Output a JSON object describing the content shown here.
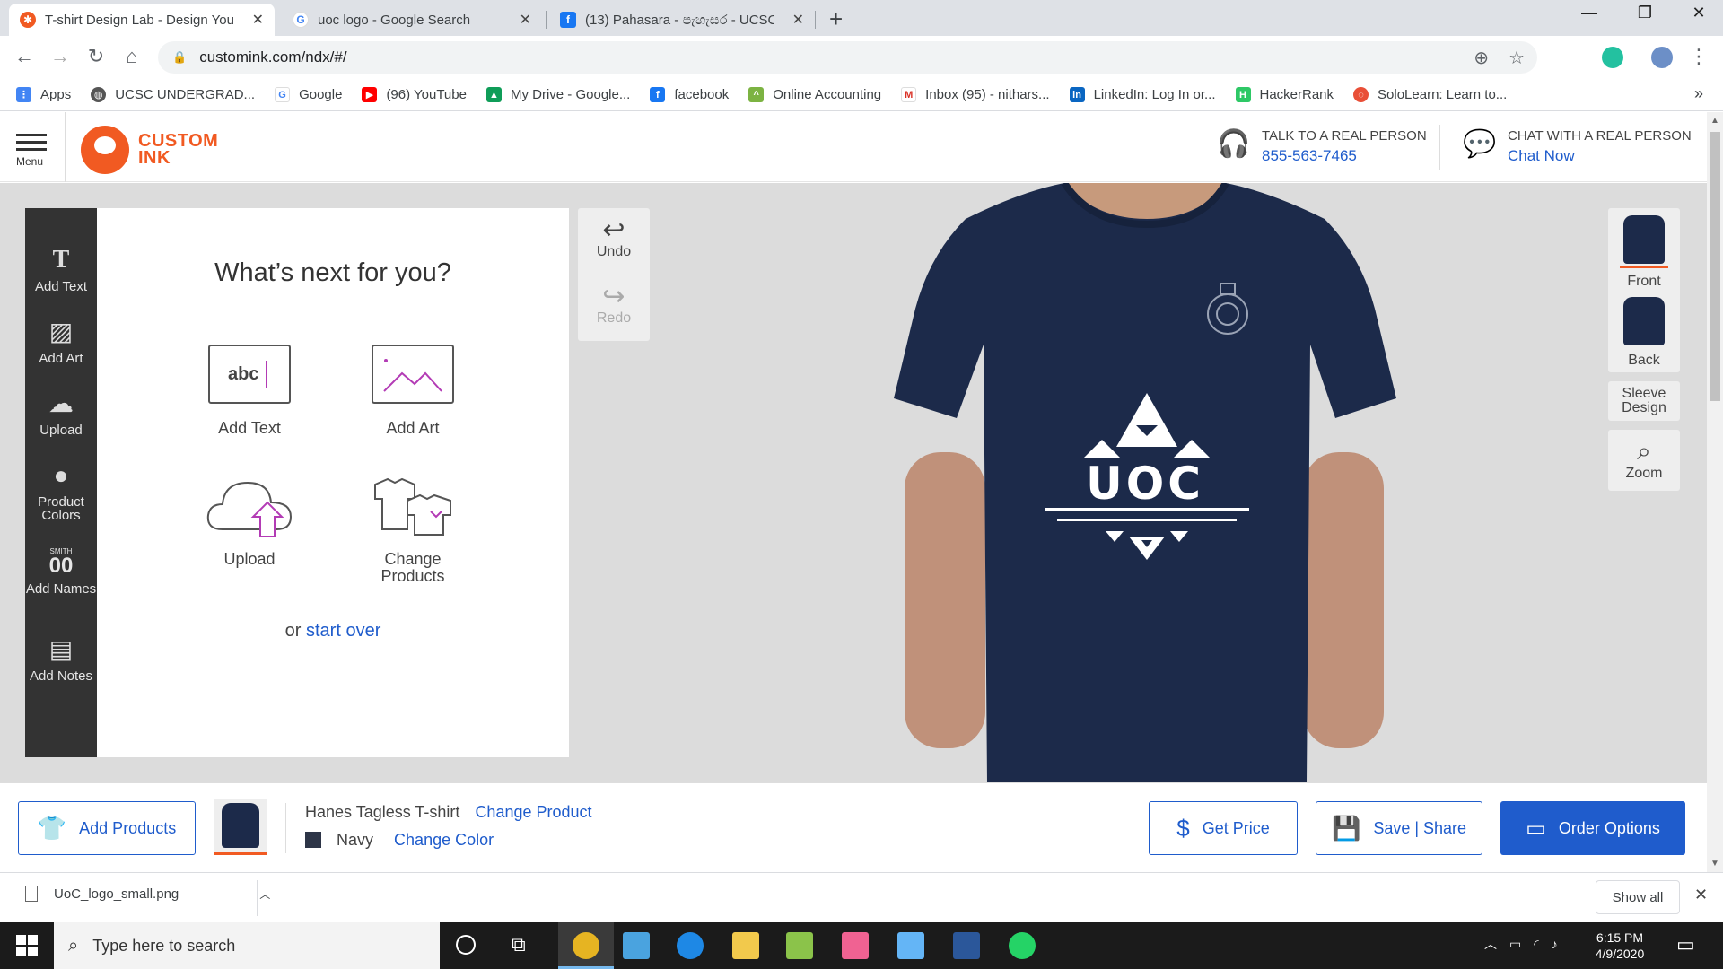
{
  "browser": {
    "tabs": [
      {
        "title": "T-shirt Design Lab - Design Your",
        "favicon": "custom-ink-icon",
        "color": "#f15a22"
      },
      {
        "title": "uoc logo - Google Search",
        "favicon": "google-icon",
        "color": "#4285f4"
      },
      {
        "title": "(13) Pahasara - පැහැසර - UCSC",
        "favicon": "facebook-icon",
        "color": "#1877f2"
      }
    ],
    "url": "customink.com/ndx/#/",
    "bookmarks": [
      {
        "label": "Apps",
        "icon": "apps-grid-icon",
        "color": "#4285f4"
      },
      {
        "label": "UCSC UNDERGRAD...",
        "icon": "globe-icon",
        "color": "#555555"
      },
      {
        "label": "Google",
        "icon": "google-icon",
        "color": "#4285f4"
      },
      {
        "label": "(96) YouTube",
        "icon": "youtube-icon",
        "color": "#ff0000"
      },
      {
        "label": "My Drive - Google...",
        "icon": "drive-icon",
        "color": "#0f9d58"
      },
      {
        "label": "facebook",
        "icon": "facebook-icon",
        "color": "#1877f2"
      },
      {
        "label": "Online Accounting",
        "icon": "accounting-icon",
        "color": "#7cb342"
      },
      {
        "label": "Inbox (95) - nithars...",
        "icon": "gmail-icon",
        "color": "#d93025"
      },
      {
        "label": "LinkedIn: Log In or...",
        "icon": "linkedin-icon",
        "color": "#0a66c2"
      },
      {
        "label": "HackerRank",
        "icon": "hackerrank-icon",
        "color": "#2ec866"
      },
      {
        "label": "SoloLearn: Learn to...",
        "icon": "sololearn-icon",
        "color": "#e94f37"
      }
    ]
  },
  "site": {
    "menu_label": "Menu",
    "logo_line1": "CUSTOM",
    "logo_line2": "INK",
    "talk_label": "TALK TO A REAL PERSON",
    "talk_phone": "855-563-7465",
    "chat_label": "CHAT WITH A REAL PERSON",
    "chat_link": "Chat Now"
  },
  "toolbar": {
    "items": [
      {
        "label": "Add Text",
        "icon": "text-icon"
      },
      {
        "label": "Add Art",
        "icon": "image-icon"
      },
      {
        "label": "Upload",
        "icon": "cloud-upload-icon"
      },
      {
        "label": "Product Colors",
        "icon": "color-drop-icon"
      },
      {
        "label": "Add Names",
        "icon": "names-icon",
        "badge": "SMITH",
        "number": "00"
      },
      {
        "label": "Add Notes",
        "icon": "notes-icon"
      }
    ]
  },
  "panel": {
    "title": "What’s next for you?",
    "options": [
      {
        "label": "Add Text",
        "icon": "text-box-icon",
        "sample": "abc"
      },
      {
        "label": "Add Art",
        "icon": "art-icon"
      },
      {
        "label": "Upload",
        "icon": "cloud-upload-icon"
      },
      {
        "label": "Change Products",
        "icon": "change-products-icon"
      }
    ],
    "or_text": "or",
    "start_over": "start over"
  },
  "history": {
    "undo": "Undo",
    "redo": "Redo"
  },
  "design": {
    "shirt_color": "#1c2a4a",
    "logo_text": "UOC"
  },
  "views": {
    "front": "Front",
    "back": "Back",
    "sleeve": "Sleeve Design",
    "zoom": "Zoom"
  },
  "bottom": {
    "add_products": "Add Products",
    "product_name": "Hanes Tagless T-shirt",
    "change_product": "Change Product",
    "color_name": "Navy",
    "change_color": "Change Color",
    "get_price": "Get Price",
    "save_share": "Save | Share",
    "order_options": "Order Options"
  },
  "downloads": {
    "file": "UoC_logo_small.png",
    "show_all": "Show all"
  },
  "taskbar": {
    "search_placeholder": "Type here to search",
    "time": "6:15 PM",
    "date": "4/9/2020"
  }
}
